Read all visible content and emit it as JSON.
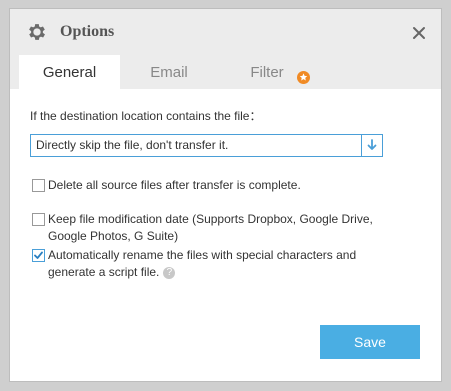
{
  "dialog": {
    "title": "Options"
  },
  "tabs": [
    {
      "label": "General",
      "active": true
    },
    {
      "label": "Email",
      "active": false
    },
    {
      "label": "Filter",
      "active": false
    }
  ],
  "general": {
    "destination_label": "If the destination location contains the file：",
    "destination_select": {
      "selected": "Directly skip the file, don't transfer it."
    },
    "options": [
      {
        "label": "Delete all source files after transfer is complete.",
        "checked": false
      },
      {
        "label": "Keep file modification date (Supports Dropbox, Google Drive, Google Photos, G Suite)",
        "checked": false
      },
      {
        "label": "Automatically rename the files with special characters and generate a script file.",
        "checked": true
      }
    ],
    "help_glyph": "?"
  },
  "footer": {
    "save_label": "Save"
  },
  "colors": {
    "accent": "#4aaee3",
    "select_border": "#4a9fd8",
    "badge": "#f08a24",
    "titlebar_bg": "#ececec"
  },
  "icons": {
    "title": "gear-icon",
    "close": "close-icon",
    "filter_badge": "star-badge-icon",
    "select": "arrow-down-icon",
    "help": "question-icon"
  }
}
